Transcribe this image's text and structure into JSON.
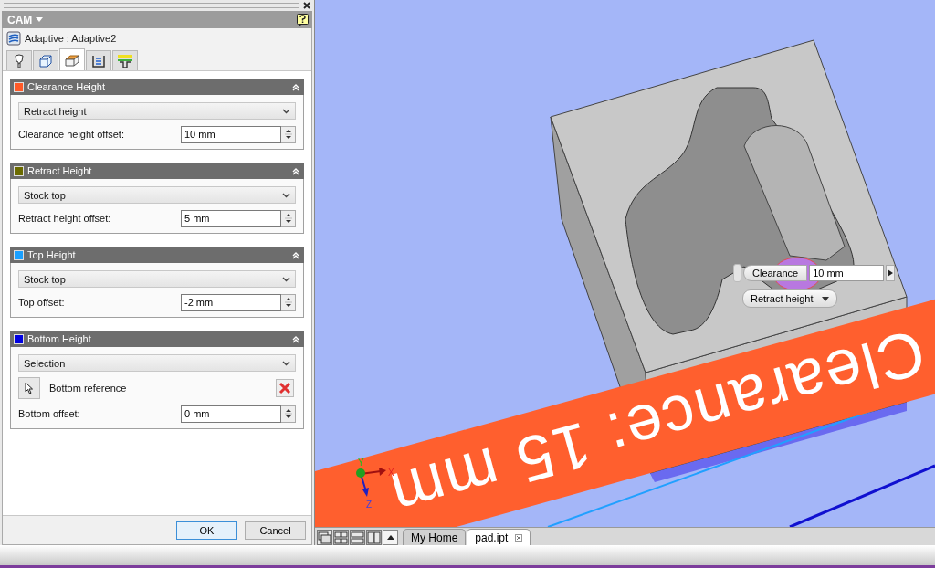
{
  "panel": {
    "title": "CAM",
    "operation": "Adaptive : Adaptive2"
  },
  "tabs": [
    {
      "selected": false
    },
    {
      "selected": false
    },
    {
      "selected": true
    },
    {
      "selected": false
    },
    {
      "selected": false
    }
  ],
  "sections": [
    {
      "title": "Clearance Height",
      "color": "#ff5a28",
      "expanded": true,
      "rows": [
        {
          "kind": "dropdown",
          "value": "Retract height"
        },
        {
          "kind": "spinner",
          "label": "Clearance height offset:",
          "value": "10 mm"
        }
      ]
    },
    {
      "title": "Retract Height",
      "color": "#6b6b00",
      "expanded": true,
      "rows": [
        {
          "kind": "dropdown",
          "value": "Stock top"
        },
        {
          "kind": "spinner",
          "label": "Retract height offset:",
          "value": "5 mm"
        }
      ]
    },
    {
      "title": "Top Height",
      "color": "#1aa0ff",
      "expanded": true,
      "rows": [
        {
          "kind": "dropdown",
          "value": "Stock top"
        },
        {
          "kind": "spinner",
          "label": "Top offset:",
          "value": "-2 mm"
        }
      ]
    },
    {
      "title": "Bottom Height",
      "color": "#0000e0",
      "expanded": true,
      "rows": [
        {
          "kind": "dropdown",
          "value": "Selection"
        },
        {
          "kind": "reference",
          "label": "Bottom reference"
        },
        {
          "kind": "spinner",
          "label": "Bottom offset:",
          "value": "0 mm"
        }
      ]
    }
  ],
  "buttons": [
    {
      "label": "OK",
      "default": true
    },
    {
      "label": "Cancel",
      "default": false
    }
  ],
  "viewport": {
    "banner": "Clearance: 15 mm",
    "manipulator": {
      "button": "Clearance",
      "value": "10 mm",
      "dropdown": "Retract height"
    },
    "axis_labels": [
      "X",
      "Y",
      "Z"
    ]
  },
  "document_tabs": [
    {
      "label": "My Home",
      "selected": false
    },
    {
      "label": "pad.ipt",
      "selected": true
    }
  ]
}
